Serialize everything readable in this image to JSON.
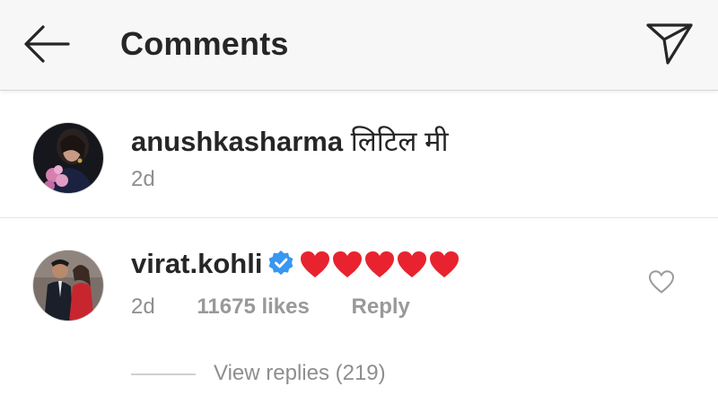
{
  "header": {
    "title": "Comments",
    "back_icon": "arrow-left-icon",
    "send_icon": "paper-plane-icon"
  },
  "comments": [
    {
      "username": "anushkasharma",
      "text": "लिटिल मी",
      "age": "2d",
      "verified": false
    },
    {
      "username": "virat.kohli",
      "text": "❤❤❤❤❤",
      "age": "2d",
      "likes": "11675 likes",
      "reply_label": "Reply",
      "verified": true,
      "view_replies": "View replies (219)"
    }
  ],
  "colors": {
    "header_bg": "#f7f7f7",
    "text": "#262626",
    "muted": "#8e8e8e",
    "verified_blue": "#3897f0",
    "heart_red": "#e8232f"
  }
}
